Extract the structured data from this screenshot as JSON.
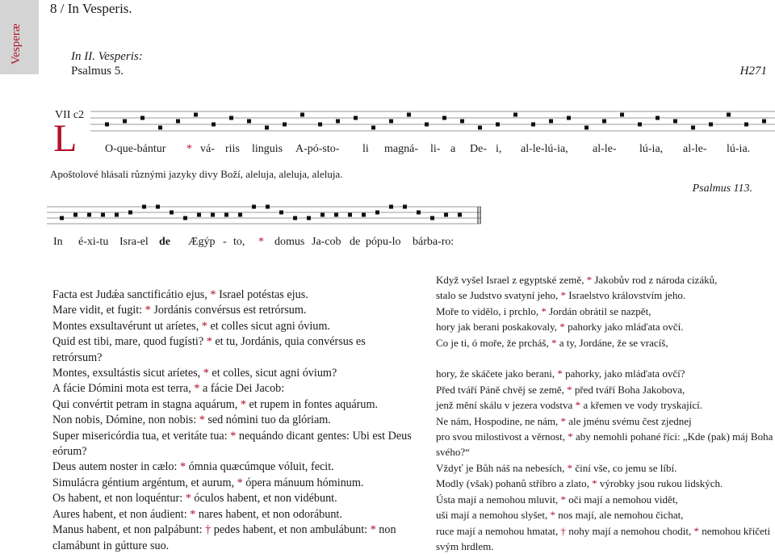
{
  "side_tab": "Vesperæ",
  "header": "8 / In Vesperis.",
  "office": "In II. Vesperis:",
  "psalm_title": "Psalmus 5.",
  "reference": "H271",
  "mode": "VII c2",
  "initial": "L",
  "antiphon_syllables": [
    "O-que-bántur",
    "*",
    "vá-",
    "riis",
    "linguis",
    "A-pó-sto-",
    "li",
    "magná-",
    "li-",
    "a",
    "De-",
    "i,",
    "al-le-lú-ia,",
    "al-le-",
    "lú-ia,",
    "al-le-",
    "lú-ia."
  ],
  "antiphon_czech": "Apoštolové hlásali různými jazyky divy Boží, aleluja, aleluja, aleluja.",
  "psalm_heading": "Psalmus 113.",
  "tone_syllables": [
    "In",
    "é-xi-tu",
    "Isra-el",
    "de",
    "Ægýp",
    "-",
    "to,",
    "*",
    "domus",
    "Ja-cob",
    "de",
    "pópu-lo",
    "bárba-ro:"
  ],
  "latin_verses": [
    "Facta est Judǽa sanctificátio ejus, * Israel potéstas ejus.",
    "Mare vidit, et fugit: * Jordánis convérsus est retrórsum.",
    "Montes exsultavérunt ut aríetes, * et colles sicut agni óvium.",
    "Quid est tibi, mare, quod fugísti? * et tu, Jordánis, quia convérsus es retrórsum?",
    "Montes, exsultástis sicut aríetes, * et colles, sicut agni óvium?",
    "A fácie Dómini mota est terra, * a fácie Dei Jacob:",
    "Qui convértit petram in stagna aquárum, * et rupem in fontes aquárum.",
    "Non nobis, Dómine, non nobis: * sed nómini tuo da glóriam.",
    "Super misericórdia tua, et veritáte tua: * nequándo dicant gentes: Ubi est Deus eórum?",
    "Deus autem noster in cælo: * ómnia quæcúmque vóluit, fecit.",
    "Simulácra géntium argéntum, et aurum, * ópera mánuum hóminum.",
    "Os habent, et non loquéntur: * óculos habent, et non vidébunt.",
    "Aures habent, et non áudient: * nares habent, et non odorábunt.",
    "Manus habent, et non palpábunt: † pedes habent, et non ambulábunt: * non clamábunt in gútture suo."
  ],
  "czech_verses": [
    "Když vyšel Israel z egyptské země, * Jakobův rod z národa cizáků,",
    "stalo se Judstvo svatyní jeho, * Israelstvo královstvím jeho.",
    "Moře to vidělo, i prchlo, * Jordán obrátil se nazpět,",
    "hory jak berani poskakovaly, * pahorky jako mláďata ovčí.",
    "Co je ti, ó moře, že prcháš, * a ty, Jordáne, že se vracíš,",
    "",
    "hory, že skáčete jako berani, * pahorky, jako mláďata ovčí?",
    "Před tváří Páně chvěj se země, * před tváří Boha Jakobova,",
    "jenž mění skálu v jezera vodstva * a křemen ve vody tryskající.",
    "Ne nám, Hospodine, ne nám, * ale jménu svému čest zjednej",
    "pro svou milostivost a věrnost, * aby nemohli pohané říci: „Kde (pak) máj Boha svého?“",
    "Vždyť je Bůh náš na nebesích, * činí vše, co jemu se líbí.",
    "Modly (však) pohanů stříbro a zlato, * výrobky jsou rukou lidských.",
    "Ústa mají a nemohou mluvit, * oči mají a nemohou vidět,",
    "uši mají a nemohou slyšet, * nos mají, ale nemohou čichat,",
    "ruce mají a nemohou hmatat, † nohy mají a nemohou chodit, * nemohou křičeti svým hrdlem."
  ],
  "colors": {
    "rubric": "#b0122a",
    "tab": "#d4d4d4"
  }
}
